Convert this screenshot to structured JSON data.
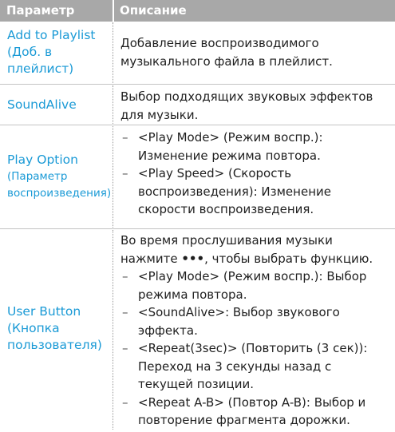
{
  "header": {
    "col1": "Параметр",
    "col2": "Описание"
  },
  "rows": [
    {
      "param_lines": [
        "Add to Playlist",
        "(Доб. в",
        "плейлист)"
      ],
      "desc": "Добавление воспроизводимого музыкального файла в плейлист."
    },
    {
      "param_lines": [
        "SoundAlive"
      ],
      "desc": "Выбор подходящих звуковых эффектов для музыки."
    },
    {
      "param_lines": [
        "Play Option"
      ],
      "param_sub": [
        "(Параметр",
        "воспроизведения)"
      ],
      "items": [
        "<Play Mode> (Режим воспр.): Изменение режима повтора.",
        "<Play Speed> (Скорость воспроизведения): Изменение скорости воспроизведения."
      ]
    },
    {
      "param_lines": [
        "User Button",
        "(Кнопка",
        "пользователя)"
      ],
      "intro_before": "Во время прослушивания музыки нажмите",
      "intro_icon": "•••",
      "intro_after": ", чтобы выбрать функцию.",
      "items": [
        "<Play Mode> (Режим воспр.): Выбор режима повтора.",
        "<SoundAlive>: Выбор звукового эффекта.",
        "<Repeat(3sec)> (Повторить (3 сек)): Переход на 3 секунды назад с текущей позиции.",
        "<Repeat A-B> (Повтор A-B): Выбор и повторение фрагмента дорожки."
      ]
    }
  ],
  "dash_glyph": "–",
  "colors": {
    "header_bg": "#a8a8a8",
    "param_text": "#1a9ad6",
    "body_text": "#1f1f1f"
  }
}
